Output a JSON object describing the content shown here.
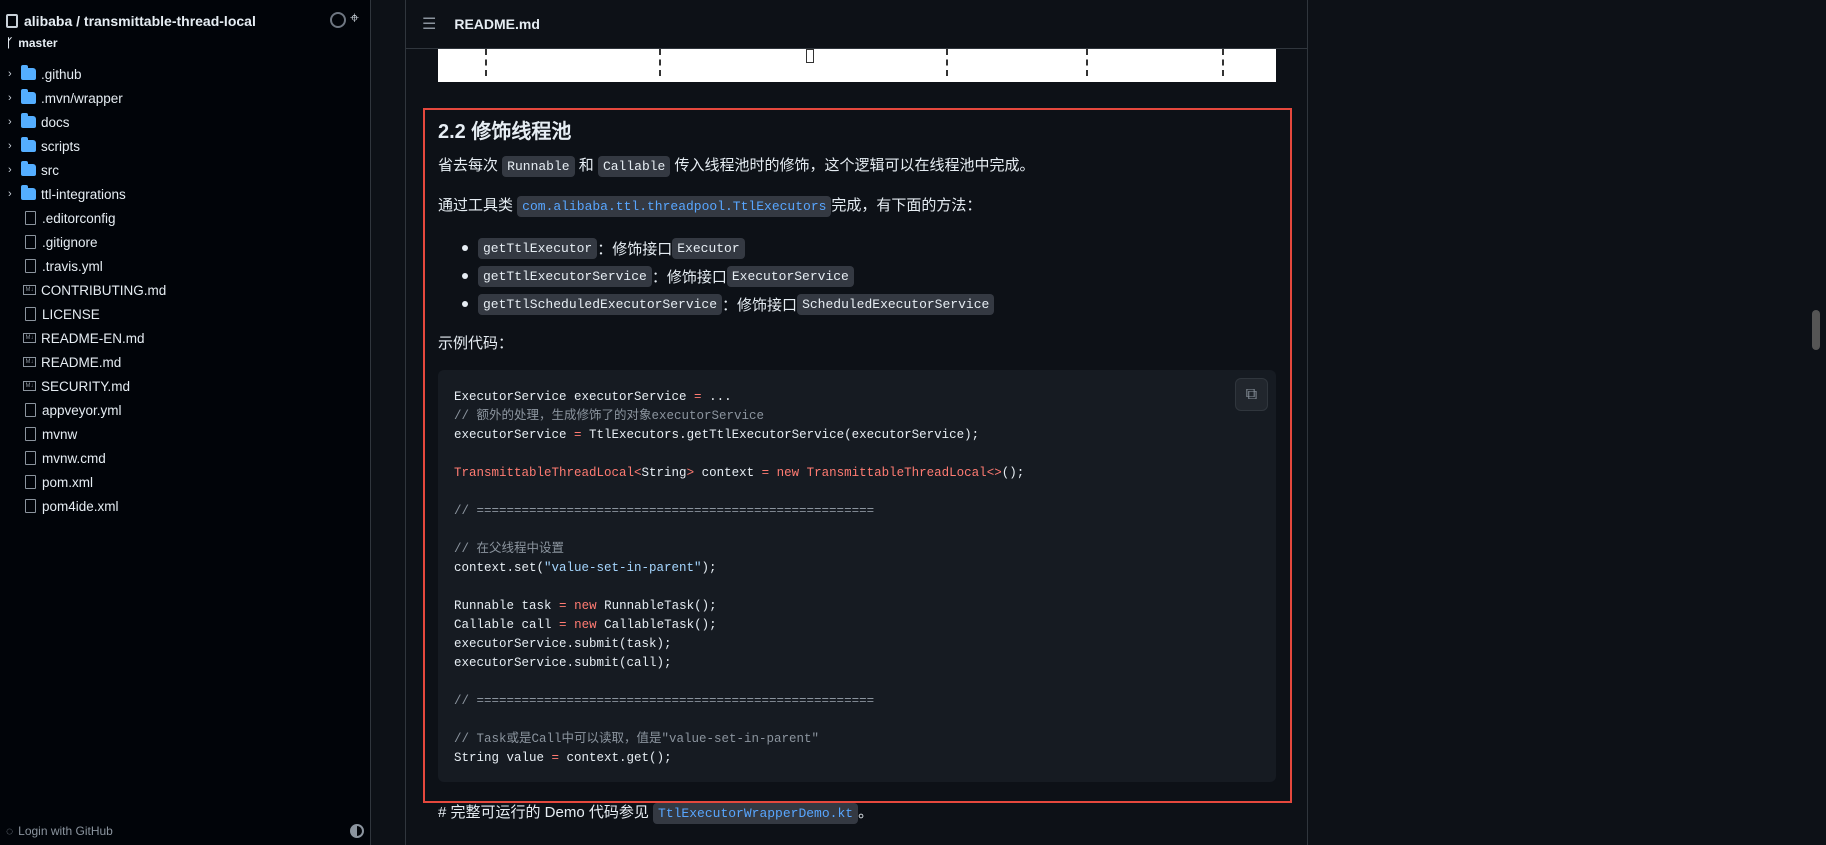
{
  "sidebar": {
    "repo": "alibaba / transmittable-thread-local",
    "branch": "master",
    "items": [
      {
        "name": ".github",
        "type": "folder"
      },
      {
        "name": ".mvn/wrapper",
        "type": "folder"
      },
      {
        "name": "docs",
        "type": "folder"
      },
      {
        "name": "scripts",
        "type": "folder"
      },
      {
        "name": "src",
        "type": "folder"
      },
      {
        "name": "ttl-integrations",
        "type": "folder"
      },
      {
        "name": ".editorconfig",
        "type": "file"
      },
      {
        "name": ".gitignore",
        "type": "file"
      },
      {
        "name": ".travis.yml",
        "type": "file"
      },
      {
        "name": "CONTRIBUTING.md",
        "type": "md"
      },
      {
        "name": "LICENSE",
        "type": "file"
      },
      {
        "name": "README-EN.md",
        "type": "md"
      },
      {
        "name": "README.md",
        "type": "md"
      },
      {
        "name": "SECURITY.md",
        "type": "md"
      },
      {
        "name": "appveyor.yml",
        "type": "file"
      },
      {
        "name": "mvnw",
        "type": "file"
      },
      {
        "name": "mvnw.cmd",
        "type": "file"
      },
      {
        "name": "pom.xml",
        "type": "file"
      },
      {
        "name": "pom4ide.xml",
        "type": "file"
      }
    ],
    "login": "Login with GitHub"
  },
  "main": {
    "file": "README.md",
    "heading": "2.2 修饰线程池",
    "p1": [
      "省去每次 ",
      "Runnable",
      " 和 ",
      "Callable",
      " 传入线程池时的修饰，这个逻辑可以在线程池中完成。"
    ],
    "p2": [
      "通过工具类 ",
      "com.alibaba.ttl.threadpool.TtlExecutors",
      "完成，有下面的方法："
    ],
    "methods": [
      {
        "name": "getTtlExecutor",
        "text": "：修饰接口 ",
        "type": "Executor"
      },
      {
        "name": "getTtlExecutorService",
        "text": "：修饰接口 ",
        "type": "ExecutorService"
      },
      {
        "name": "getTtlScheduledExecutorService",
        "text": "：修饰接口 ",
        "type": "ScheduledExecutorService"
      }
    ],
    "sample": "示例代码：",
    "bottom": [
      "# 完整可运行的 Demo 代码参见 ",
      "TtlExecutorWrapperDemo.kt",
      "。"
    ]
  }
}
